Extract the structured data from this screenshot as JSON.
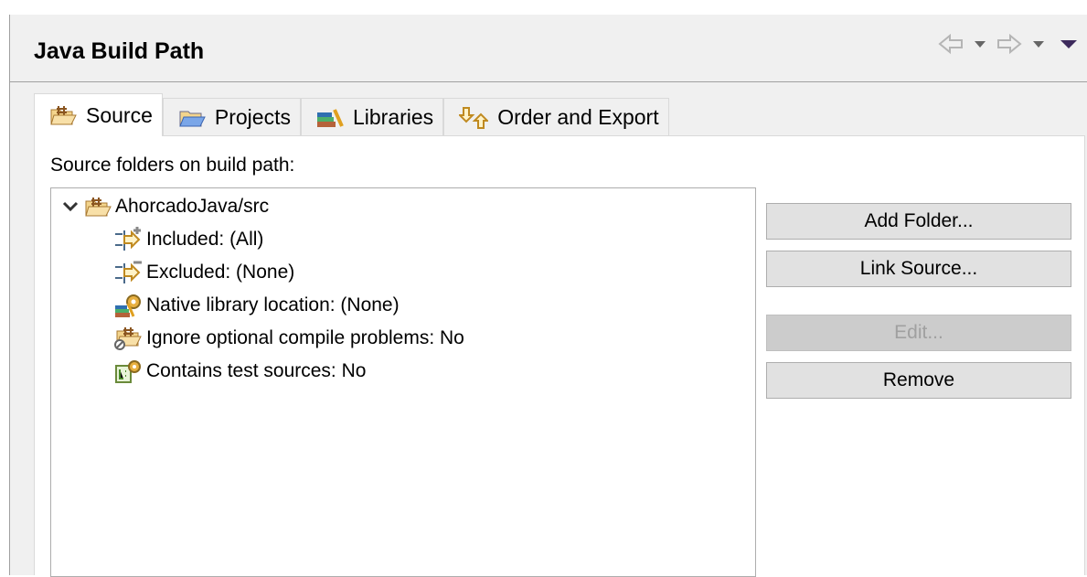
{
  "header": {
    "title": "Java Build Path"
  },
  "nav": {
    "back_icon": "arrow-left-icon",
    "forward_icon": "arrow-right-icon",
    "menu_icon": "view-menu-icon"
  },
  "tabs": [
    {
      "label": "Source",
      "icon": "source-folder-icon",
      "active": true
    },
    {
      "label": "Projects",
      "icon": "projects-folder-icon"
    },
    {
      "label": "Libraries",
      "icon": "libraries-icon"
    },
    {
      "label": "Order and Export",
      "icon": "order-export-icon"
    }
  ],
  "source": {
    "label": "Source folders on build path:",
    "tree": {
      "root": "AhorcadoJava/src",
      "children": [
        "Included: (All)",
        "Excluded: (None)",
        "Native library location: (None)",
        "Ignore optional compile problems: No",
        "Contains test sources: No"
      ]
    },
    "buttons": [
      {
        "label": "Add Folder...",
        "enabled": true
      },
      {
        "label": "Link Source...",
        "enabled": true
      },
      {
        "label": "Edit...",
        "enabled": false
      },
      {
        "label": "Remove",
        "enabled": true
      }
    ]
  }
}
